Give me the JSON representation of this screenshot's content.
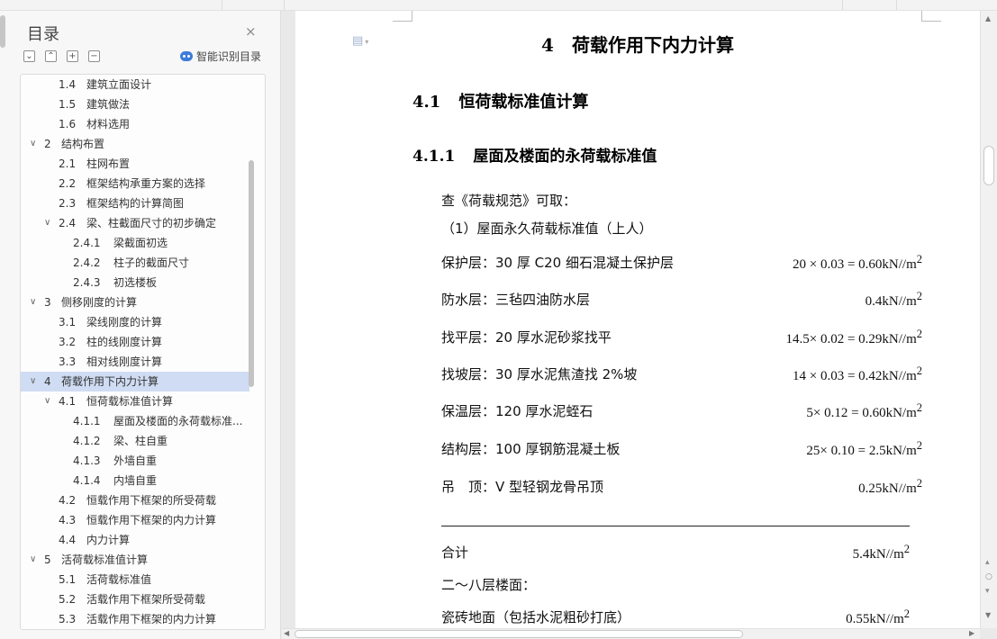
{
  "nav": {
    "title": "目录",
    "close": "×",
    "tools": [
      "⌄",
      "⌃",
      "+",
      "−"
    ],
    "smart_label": "智能识别目录",
    "items": [
      {
        "caret": "",
        "num": "1.4",
        "text": "建筑立面设计",
        "level": 2
      },
      {
        "caret": "",
        "num": "1.5",
        "text": "建筑做法",
        "level": 2
      },
      {
        "caret": "",
        "num": "1.6",
        "text": "材料选用",
        "level": 2
      },
      {
        "caret": "∨",
        "num": "2",
        "text": "结构布置",
        "level": 1
      },
      {
        "caret": "",
        "num": "2.1",
        "text": "柱网布置",
        "level": 2
      },
      {
        "caret": "",
        "num": "2.2",
        "text": "框架结构承重方案的选择",
        "level": 2
      },
      {
        "caret": "",
        "num": "2.3",
        "text": "框架结构的计算简图",
        "level": 2
      },
      {
        "caret": "∨",
        "num": "2.4",
        "text": "梁、柱截面尺寸的初步确定",
        "level": 2
      },
      {
        "caret": "",
        "num": "2.4.1",
        "text": "梁截面初选",
        "level": 3
      },
      {
        "caret": "",
        "num": "2.4.2",
        "text": "柱子的截面尺寸",
        "level": 3
      },
      {
        "caret": "",
        "num": "2.4.3",
        "text": "初选楼板",
        "level": 3
      },
      {
        "caret": "∨",
        "num": "3",
        "text": "侧移刚度的计算",
        "level": 1
      },
      {
        "caret": "",
        "num": "3.1",
        "text": "梁线刚度的计算",
        "level": 2
      },
      {
        "caret": "",
        "num": "3.2",
        "text": "柱的线刚度计算",
        "level": 2
      },
      {
        "caret": "",
        "num": "3.3",
        "text": "相对线刚度计算",
        "level": 2
      },
      {
        "caret": "∨",
        "num": "4",
        "text": "荷载作用下内力计算",
        "level": 1,
        "selected": true
      },
      {
        "caret": "∨",
        "num": "4.1",
        "text": "恒荷载标准值计算",
        "level": 2
      },
      {
        "caret": "",
        "num": "4.1.1",
        "text": "屋面及楼面的永荷载标准...",
        "level": 3
      },
      {
        "caret": "",
        "num": "4.1.2",
        "text": "梁、柱自重",
        "level": 3
      },
      {
        "caret": "",
        "num": "4.1.3",
        "text": "外墙自重",
        "level": 3
      },
      {
        "caret": "",
        "num": "4.1.4",
        "text": "内墙自重",
        "level": 3
      },
      {
        "caret": "",
        "num": "4.2",
        "text": "恒载作用下框架的所受荷载",
        "level": 2
      },
      {
        "caret": "",
        "num": "4.3",
        "text": "恒载作用下框架的内力计算",
        "level": 2
      },
      {
        "caret": "",
        "num": "4.4",
        "text": "内力计算",
        "level": 2
      },
      {
        "caret": "∨",
        "num": "5",
        "text": "活荷载标准值计算",
        "level": 1
      },
      {
        "caret": "",
        "num": "5.1",
        "text": "活荷载标准值",
        "level": 2
      },
      {
        "caret": "",
        "num": "5.2",
        "text": "活载作用下框架所受荷载",
        "level": 2
      },
      {
        "caret": "",
        "num": "5.3",
        "text": "活载作用下框架的内力计算",
        "level": 2
      }
    ]
  },
  "doc": {
    "icon": "document-icon",
    "h1_num": "4",
    "h1_text": "荷载作用下内力计算",
    "h2_num": "4.1",
    "h2_text": "恒荷载标准值计算",
    "h3_num": "4.1.1",
    "h3_text": "屋面及楼面的永荷载标准值",
    "p1": "查《荷载规范》可取：",
    "p2": "（1）屋面永久荷载标准值（上人）",
    "rows": [
      {
        "label": "保护层：30 厚 C20 细石混凝土保护层",
        "value": "20 × 0.03 = 0.60kN//m",
        "sup": "2"
      },
      {
        "label": "防水层：三毡四油防水层",
        "value": "0.4kN//m",
        "sup": "2"
      },
      {
        "label": "找平层：20 厚水泥砂浆找平",
        "value": "14.5× 0.02 = 0.29kN//m",
        "sup": "2"
      },
      {
        "label": "找坡层：30 厚水泥焦渣找 2%坡",
        "value": "14 × 0.03 = 0.42kN//m",
        "sup": "2"
      },
      {
        "label": "保温层：120 厚水泥蛭石",
        "value": "5× 0.12 = 0.60kN/m",
        "sup": "2"
      },
      {
        "label": "结构层：100 厚钢筋混凝土板",
        "value": "25× 0.10 = 2.5kN/m",
        "sup": "2"
      },
      {
        "label": "吊　顶：V 型轻钢龙骨吊顶",
        "value": "0.25kN//m",
        "sup": "2"
      }
    ],
    "total_label": "合计",
    "total_value": "5.4kN//m",
    "total_sup": "2",
    "p3": "二～八层楼面：",
    "last_label": "瓷砖地面（包括水泥粗砂打底）",
    "last_value": "0.55kN//m",
    "last_sup": "2"
  }
}
